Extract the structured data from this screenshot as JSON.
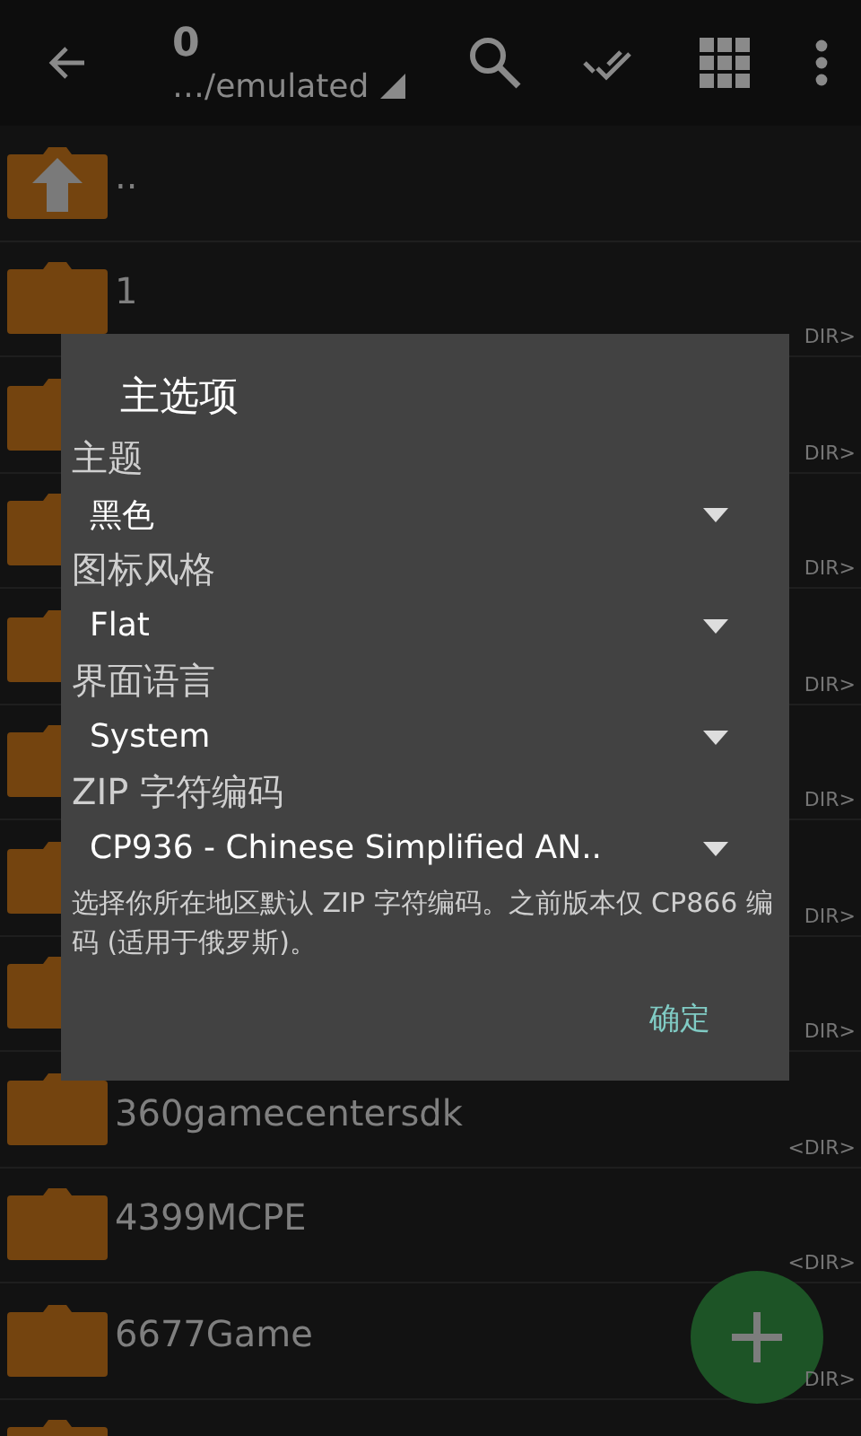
{
  "toolbar": {
    "title": "0",
    "path": "…/emulated"
  },
  "files": [
    {
      "kind": "up",
      "name": ".."
    },
    {
      "kind": "folder",
      "name": "1",
      "tag": "DIR>"
    },
    {
      "kind": "folder",
      "tag": "DIR>"
    },
    {
      "kind": "folder",
      "tag": "DIR>"
    },
    {
      "kind": "folder",
      "tag": "DIR>"
    },
    {
      "kind": "folder",
      "tag": "DIR>"
    },
    {
      "kind": "folder",
      "tag": "DIR>"
    },
    {
      "kind": "folder",
      "tag": "DIR>"
    },
    {
      "kind": "folder",
      "name": "360gamecentersdk",
      "tag": "<DIR>"
    },
    {
      "kind": "folder",
      "name": "4399MCPE",
      "tag": "<DIR>"
    },
    {
      "kind": "folder",
      "name": "6677Game",
      "tag": "DIR>"
    },
    {
      "kind": "folder"
    }
  ],
  "dialog": {
    "title": "主选项",
    "settings": [
      {
        "label": "主题",
        "value": "黑色"
      },
      {
        "label": "图标风格",
        "value": "Flat"
      },
      {
        "label": "界面语言",
        "value": "System"
      },
      {
        "label": "ZIP 字符编码",
        "value": "CP936 - Chinese Simplified AN.."
      }
    ],
    "note": "选择你所在地区默认 ZIP 字符编码。之前版本仅 CP866 编码 (适用于俄罗斯)。",
    "button": "确定"
  }
}
